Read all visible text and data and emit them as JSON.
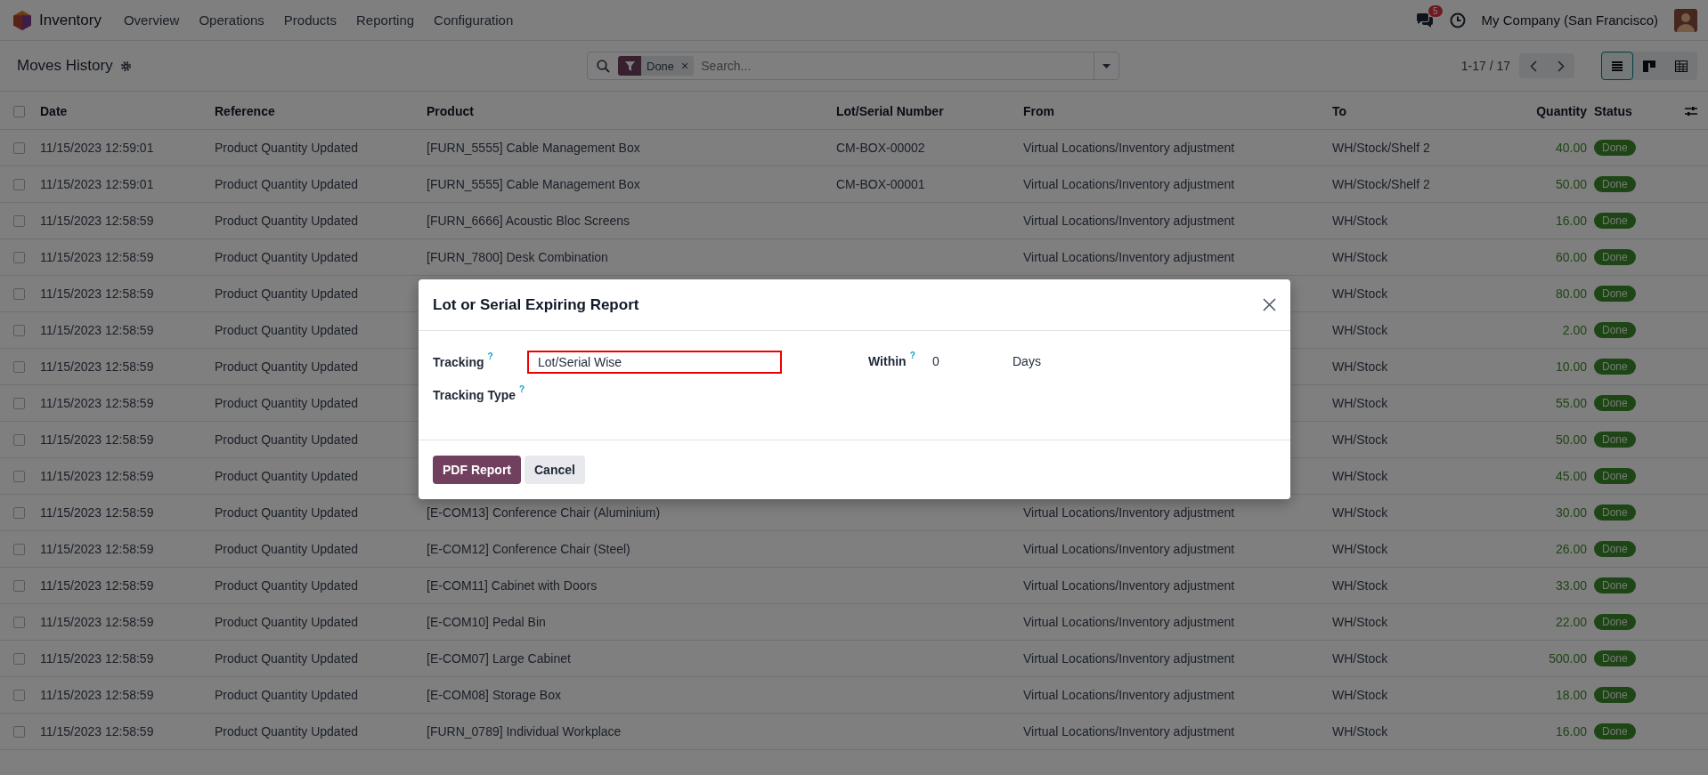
{
  "navbar": {
    "app_name": "Inventory",
    "menu": [
      "Overview",
      "Operations",
      "Products",
      "Reporting",
      "Configuration"
    ],
    "messages_badge": "5",
    "company": "My Company (San Francisco)"
  },
  "control_panel": {
    "title": "Moves History",
    "search": {
      "facet": "Done",
      "remove": "×",
      "placeholder": "Search..."
    },
    "pager": "1-17 / 17",
    "views": [
      {
        "kind": "list",
        "selected": true
      },
      {
        "kind": "kanban",
        "selected": false
      },
      {
        "kind": "pivot",
        "selected": false
      }
    ]
  },
  "table": {
    "select_all_checked": false,
    "columns": [
      "Date",
      "Reference",
      "Product",
      "Lot/Serial Number",
      "From",
      "To",
      "Quantity",
      "Status"
    ],
    "rows": [
      {
        "checked": false,
        "date": "11/15/2023 12:59:01",
        "reference": "Product Quantity Updated",
        "product": "[FURN_5555] Cable Management Box",
        "lot": "CM-BOX-00002",
        "from": "Virtual Locations/Inventory adjustment",
        "to": "WH/Stock/Shelf 2",
        "quantity": "40.00",
        "status": "Done"
      },
      {
        "checked": false,
        "date": "11/15/2023 12:59:01",
        "reference": "Product Quantity Updated",
        "product": "[FURN_5555] Cable Management Box",
        "lot": "CM-BOX-00001",
        "from": "Virtual Locations/Inventory adjustment",
        "to": "WH/Stock/Shelf 2",
        "quantity": "50.00",
        "status": "Done"
      },
      {
        "checked": false,
        "date": "11/15/2023 12:58:59",
        "reference": "Product Quantity Updated",
        "product": "[FURN_6666] Acoustic Bloc Screens",
        "from": "Virtual Locations/Inventory adjustment",
        "to": "WH/Stock",
        "quantity": "16.00",
        "status": "Done"
      },
      {
        "checked": false,
        "date": "11/15/2023 12:58:59",
        "reference": "Product Quantity Updated",
        "product": "[FURN_7800] Desk Combination",
        "from": "Virtual Locations/Inventory adjustment",
        "to": "WH/Stock",
        "quantity": "60.00",
        "status": "Done"
      },
      {
        "checked": false,
        "date": "11/15/2023 12:58:59",
        "reference": "Product Quantity Updated",
        "to": "WH/Stock",
        "quantity": "80.00",
        "status": "Done"
      },
      {
        "checked": false,
        "date": "11/15/2023 12:58:59",
        "reference": "Product Quantity Updated",
        "to": "WH/Stock",
        "quantity": "2.00",
        "status": "Done"
      },
      {
        "checked": false,
        "date": "11/15/2023 12:58:59",
        "reference": "Product Quantity Updated",
        "to": "WH/Stock",
        "quantity": "10.00",
        "status": "Done"
      },
      {
        "checked": false,
        "date": "11/15/2023 12:58:59",
        "reference": "Product Quantity Updated",
        "to": "WH/Stock",
        "quantity": "55.00",
        "status": "Done"
      },
      {
        "checked": false,
        "date": "11/15/2023 12:58:59",
        "reference": "Product Quantity Updated",
        "to": "WH/Stock",
        "quantity": "50.00",
        "status": "Done"
      },
      {
        "checked": false,
        "date": "11/15/2023 12:58:59",
        "reference": "Product Quantity Updated",
        "to": "WH/Stock",
        "quantity": "45.00",
        "status": "Done"
      },
      {
        "checked": false,
        "date": "11/15/2023 12:58:59",
        "reference": "Product Quantity Updated",
        "product": "[E-COM13] Conference Chair (Aluminium)",
        "from": "Virtual Locations/Inventory adjustment",
        "to": "WH/Stock",
        "quantity": "30.00",
        "status": "Done"
      },
      {
        "checked": false,
        "date": "11/15/2023 12:58:59",
        "reference": "Product Quantity Updated",
        "product": "[E-COM12] Conference Chair (Steel)",
        "from": "Virtual Locations/Inventory adjustment",
        "to": "WH/Stock",
        "quantity": "26.00",
        "status": "Done"
      },
      {
        "checked": false,
        "date": "11/15/2023 12:58:59",
        "reference": "Product Quantity Updated",
        "product": "[E-COM11] Cabinet with Doors",
        "from": "Virtual Locations/Inventory adjustment",
        "to": "WH/Stock",
        "quantity": "33.00",
        "status": "Done"
      },
      {
        "checked": false,
        "date": "11/15/2023 12:58:59",
        "reference": "Product Quantity Updated",
        "product": "[E-COM10] Pedal Bin",
        "from": "Virtual Locations/Inventory adjustment",
        "to": "WH/Stock",
        "quantity": "22.00",
        "status": "Done"
      },
      {
        "checked": false,
        "date": "11/15/2023 12:58:59",
        "reference": "Product Quantity Updated",
        "product": "[E-COM07] Large Cabinet",
        "from": "Virtual Locations/Inventory adjustment",
        "to": "WH/Stock",
        "quantity": "500.00",
        "status": "Done"
      },
      {
        "checked": false,
        "date": "11/15/2023 12:58:59",
        "reference": "Product Quantity Updated",
        "product": "[E-COM08] Storage Box",
        "from": "Virtual Locations/Inventory adjustment",
        "to": "WH/Stock",
        "quantity": "18.00",
        "status": "Done"
      },
      {
        "checked": false,
        "date": "11/15/2023 12:58:59",
        "reference": "Product Quantity Updated",
        "product": "[FURN_0789] Individual Workplace",
        "from": "Virtual Locations/Inventory adjustment",
        "to": "WH/Stock",
        "quantity": "16.00",
        "status": "Done"
      }
    ]
  },
  "dialog": {
    "title": "Lot or Serial Expiring Report",
    "left_fields": [
      {
        "label": "Tracking",
        "help": "?",
        "value": "Lot/Serial Wise",
        "highlighted": true
      },
      {
        "label": "Tracking Type",
        "help": "?"
      }
    ],
    "right_fields": [
      {
        "label": "Within",
        "help": "?",
        "value": "0",
        "unit": "Days"
      }
    ],
    "buttons": [
      {
        "label": "PDF Report",
        "kind": "primary"
      },
      {
        "label": "Cancel",
        "kind": "secondary"
      }
    ]
  }
}
